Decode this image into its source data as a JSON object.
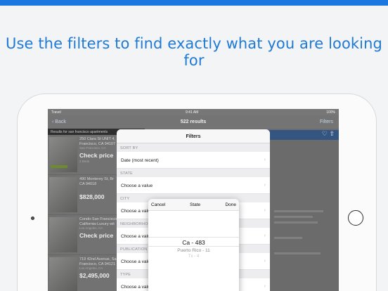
{
  "headline": "Use the filters to find exactly what you are looking for",
  "status": {
    "carrier": "Travel",
    "time": "9:41 AM",
    "battery": "100%"
  },
  "nav": {
    "back": "Back",
    "title": "522 results",
    "filters": "Filters"
  },
  "results_bar": "Results for san francisco apartments",
  "listings": [
    {
      "line1": "250 Clara St UNIT 4,",
      "line2": "Francisco, CA 94107",
      "line3": "San Francisco, CA",
      "price": "Check price",
      "sub": "2 Beds"
    },
    {
      "line1": "490 Monterey St, Br",
      "line2": "CA 94018",
      "line3": "",
      "price": "$828,000",
      "sub": ""
    },
    {
      "line1": "Condo-San Francisco",
      "line2": "California-Luxury wit",
      "line3": "Los Angeles, CA",
      "price": "Check price",
      "sub": ""
    },
    {
      "line1": "719 42nd Avenue, Sa",
      "line2": "Francisco, CA 94121",
      "line3": "Los Angeles, CA",
      "price": "$2,495,000",
      "sub": ""
    }
  ],
  "filters_panel": {
    "title": "Filters",
    "sections": [
      {
        "label": "SORT BY",
        "value": "Date (most recent)"
      },
      {
        "label": "STATE",
        "value": "Choose a value"
      },
      {
        "label": "CITY",
        "value": "Choose a value"
      },
      {
        "label": "NEIGHBORHOOD",
        "value": "Choose a value"
      },
      {
        "label": "PUBLICATION",
        "value": "Choose a value"
      },
      {
        "label": "TYPE",
        "value": "Choose a value"
      }
    ]
  },
  "picker": {
    "cancel": "Cancel",
    "title": "State",
    "done": "Done",
    "selected": "Ca - 483",
    "next1": "Puerto Rico - 11",
    "next2": "Tx - 4"
  },
  "colors": {
    "accent": "#1f7ad6",
    "brand_bar": "#1a78e0"
  }
}
